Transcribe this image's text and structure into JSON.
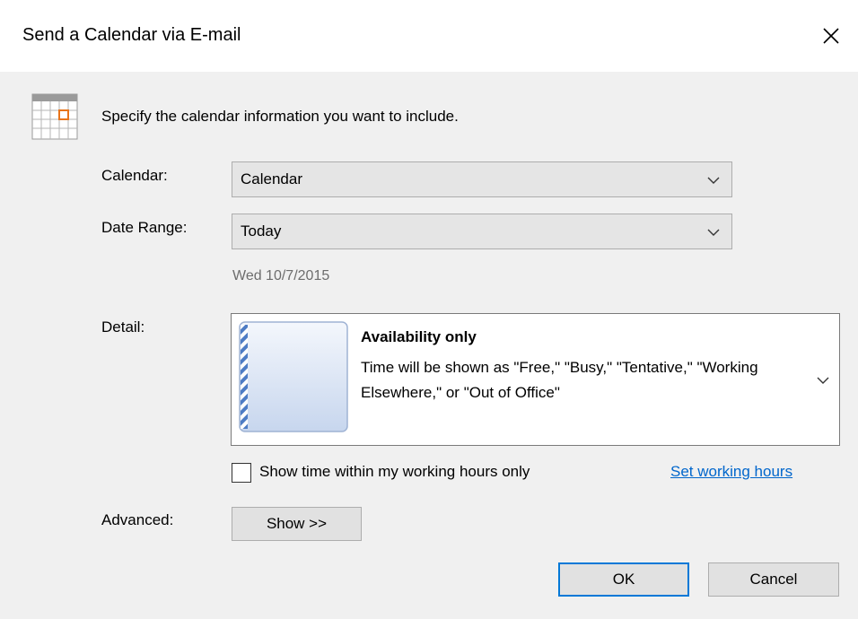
{
  "window": {
    "title": "Send a Calendar via E-mail",
    "close_glyph": "✕"
  },
  "instruction": "Specify the calendar information you want to include.",
  "calendar": {
    "label": "Calendar:",
    "selected": "Calendar"
  },
  "date_range": {
    "label": "Date Range:",
    "selected": "Today",
    "date_text": "Wed 10/7/2015"
  },
  "detail": {
    "label": "Detail:",
    "title": "Availability only",
    "description": "Time will be shown as \"Free,\" \"Busy,\" \"Tentative,\" \"Working Elsewhere,\" or \"Out of Office\""
  },
  "working_hours": {
    "checkbox_label": "Show time within my working hours only",
    "checked": false,
    "link_label": "Set working hours"
  },
  "advanced": {
    "label": "Advanced:",
    "button_label": "Show >>"
  },
  "buttons": {
    "ok": "OK",
    "cancel": "Cancel"
  },
  "colors": {
    "link": "#0066cc",
    "accent": "#0078d7",
    "calendar_highlight": "#e8741a"
  },
  "icons": [
    "calendar-icon",
    "close-icon",
    "chevron-down-icon"
  ]
}
